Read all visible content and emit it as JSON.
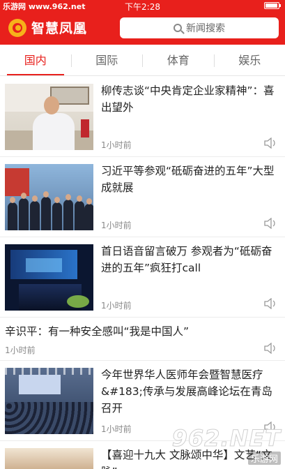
{
  "status_bar": {
    "watermark": "乐游网 www.962.net",
    "time": "下午2:28"
  },
  "header": {
    "app_name": "智慧凤凰",
    "search_placeholder": "新闻搜索"
  },
  "tabs": [
    {
      "label": "国内",
      "active": true
    },
    {
      "label": "国际",
      "active": false
    },
    {
      "label": "体育",
      "active": false
    },
    {
      "label": "娱乐",
      "active": false
    }
  ],
  "articles": [
    {
      "title": "柳传志谈“中央肯定企业家精神”：喜出望外",
      "time": "1小时前",
      "has_image": true
    },
    {
      "title": "习近平等参观“砥砺奋进的五年”大型成就展",
      "time": "1小时前",
      "has_image": true
    },
    {
      "title": "首日语音留言破万 参观者为“砥砺奋进的五年”疯狂打call",
      "time": "1小时前",
      "has_image": true
    },
    {
      "title": "辛识平：有一种安全感叫“我是中国人”",
      "time": "1小时前",
      "has_image": false
    },
    {
      "title": "今年世界华人医师年会暨智慧医疗&#183;传承与发展高峰论坛在青岛召开",
      "time": "1小时前",
      "has_image": true
    },
    {
      "title": "【喜迎十九大 文脉颂中华】文艺“文脉”",
      "time": "",
      "has_image": true
    }
  ],
  "watermark": {
    "logo_text": "962.NET",
    "sub_text": "乐游网"
  },
  "colors": {
    "brand_red": "#e8201c",
    "logo_gold": "#f7b21a",
    "tab_active": "#e8201c",
    "text_muted": "#888888"
  },
  "icons": {
    "search": "search-icon",
    "speaker": "speaker-icon",
    "battery": "battery-icon",
    "logo": "phoenix-logo-icon"
  }
}
